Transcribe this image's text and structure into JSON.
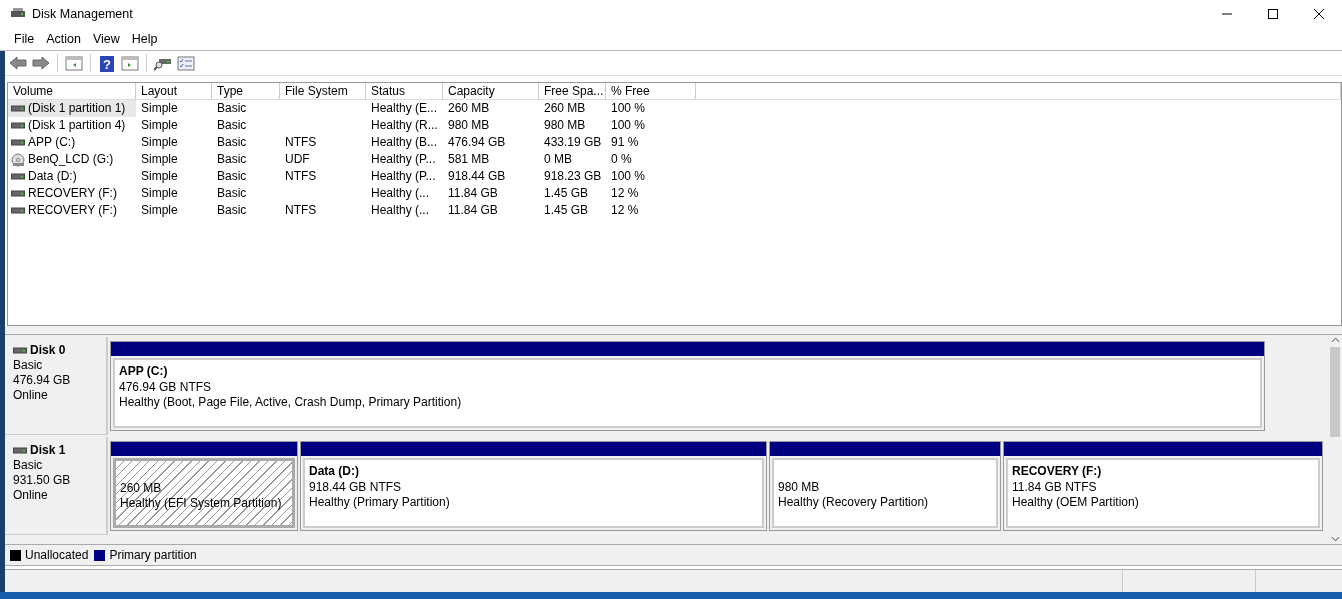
{
  "window": {
    "title": "Disk Management"
  },
  "menu": [
    "File",
    "Action",
    "View",
    "Help"
  ],
  "toolbar": {
    "help_glyph": "?"
  },
  "table": {
    "columns": [
      "Volume",
      "Layout",
      "Type",
      "File System",
      "Status",
      "Capacity",
      "Free Spa...",
      "% Free"
    ],
    "rows": [
      {
        "kind": "drive",
        "selected": true,
        "cells": [
          "(Disk 1 partition 1)",
          "Simple",
          "Basic",
          "",
          "Healthy (E...",
          "260 MB",
          "260 MB",
          "100 %"
        ]
      },
      {
        "kind": "drive",
        "selected": false,
        "cells": [
          "(Disk 1 partition 4)",
          "Simple",
          "Basic",
          "",
          "Healthy (R...",
          "980 MB",
          "980 MB",
          "100 %"
        ]
      },
      {
        "kind": "drive",
        "selected": false,
        "cells": [
          "APP (C:)",
          "Simple",
          "Basic",
          "NTFS",
          "Healthy (B...",
          "476.94 GB",
          "433.19 GB",
          "91 %"
        ]
      },
      {
        "kind": "disc",
        "selected": false,
        "cells": [
          "BenQ_LCD (G:)",
          "Simple",
          "Basic",
          "UDF",
          "Healthy (P...",
          "581 MB",
          "0 MB",
          "0 %"
        ]
      },
      {
        "kind": "drive",
        "selected": false,
        "cells": [
          "Data (D:)",
          "Simple",
          "Basic",
          "NTFS",
          "Healthy (P...",
          "918.44 GB",
          "918.23 GB",
          "100 %"
        ]
      },
      {
        "kind": "drive",
        "selected": false,
        "cells": [
          "RECOVERY (F:)",
          "Simple",
          "Basic",
          "",
          "Healthy (...",
          "11.84 GB",
          "1.45 GB",
          "12 %"
        ]
      },
      {
        "kind": "drive",
        "selected": false,
        "cells": [
          "RECOVERY (F:)",
          "Simple",
          "Basic",
          "NTFS",
          "Healthy (...",
          "11.84 GB",
          "1.45 GB",
          "12 %"
        ]
      }
    ]
  },
  "disks": [
    {
      "name": "Disk 0",
      "type": "Basic",
      "size": "476.94 GB",
      "state": "Online",
      "partitions": [
        {
          "kind": "primary",
          "selected": false,
          "title": "APP  (C:)",
          "size": "476.94 GB NTFS",
          "status": "Healthy (Boot, Page File, Active, Crash Dump, Primary Partition)"
        }
      ]
    },
    {
      "name": "Disk 1",
      "type": "Basic",
      "size": "931.50 GB",
      "state": "Online",
      "partitions": [
        {
          "kind": "primary",
          "selected": true,
          "size": "260 MB",
          "status": "Healthy (EFI System Partition)"
        },
        {
          "kind": "primary",
          "selected": false,
          "title": "Data  (D:)",
          "size": "918.44 GB NTFS",
          "status": "Healthy (Primary Partition)"
        },
        {
          "kind": "primary",
          "selected": false,
          "size": "980 MB",
          "status": "Healthy (Recovery Partition)"
        },
        {
          "kind": "primary",
          "selected": false,
          "title": "RECOVERY  (F:)",
          "size": "11.84 GB NTFS",
          "status": "Healthy (OEM Partition)"
        }
      ]
    }
  ],
  "legend": [
    {
      "kind": "unallocated",
      "label": "Unallocated",
      "color": "#000000"
    },
    {
      "kind": "primary",
      "label": "Primary partition",
      "color": "#000080"
    }
  ]
}
